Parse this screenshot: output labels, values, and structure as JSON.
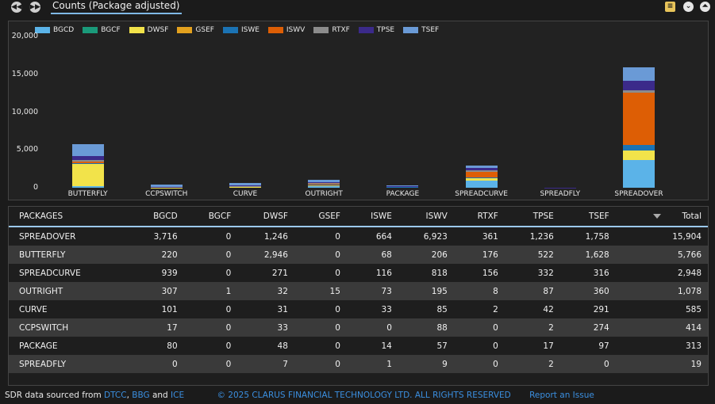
{
  "tab_label": "Counts (Package adjusted)",
  "chart_data": {
    "type": "bar",
    "stacked": true,
    "categories": [
      "BUTTERFLY",
      "CCPSWITCH",
      "CURVE",
      "OUTRIGHT",
      "PACKAGE",
      "SPREADCURVE",
      "SPREADFLY",
      "SPREADOVER"
    ],
    "yticks": [
      "0",
      "5,000",
      "10,000",
      "15,000",
      "20,000"
    ],
    "ylim": [
      0,
      20000
    ],
    "legend_position": "top-left",
    "series": [
      {
        "name": "BGCD",
        "color": "#5bb3e8",
        "values": [
          220,
          17,
          101,
          307,
          80,
          939,
          0,
          3716
        ]
      },
      {
        "name": "BGCF",
        "color": "#1a9a7a",
        "values": [
          0,
          0,
          0,
          1,
          0,
          0,
          0,
          0
        ]
      },
      {
        "name": "DWSF",
        "color": "#f2e34a",
        "values": [
          2946,
          33,
          31,
          32,
          48,
          271,
          7,
          1246
        ]
      },
      {
        "name": "GSEF",
        "color": "#e3a11e",
        "values": [
          0,
          0,
          0,
          15,
          0,
          0,
          0,
          0
        ]
      },
      {
        "name": "ISWE",
        "color": "#1b73b4",
        "values": [
          68,
          0,
          33,
          73,
          14,
          116,
          1,
          664
        ]
      },
      {
        "name": "ISWV",
        "color": "#dd5e05",
        "values": [
          206,
          88,
          85,
          195,
          57,
          818,
          9,
          6923
        ]
      },
      {
        "name": "RTXF",
        "color": "#8c8c8c",
        "values": [
          176,
          0,
          2,
          8,
          0,
          156,
          0,
          361
        ]
      },
      {
        "name": "TPSE",
        "color": "#3b2a8a",
        "values": [
          522,
          2,
          42,
          87,
          17,
          332,
          2,
          1236
        ]
      },
      {
        "name": "TSEF",
        "color": "#6a9ad6",
        "values": [
          1628,
          274,
          291,
          360,
          97,
          316,
          0,
          1758
        ]
      }
    ]
  },
  "table": {
    "headers": [
      "PACKAGES",
      "BGCD",
      "BGCF",
      "DWSF",
      "GSEF",
      "ISWE",
      "ISWV",
      "RTXF",
      "TPSE",
      "TSEF",
      "Total"
    ],
    "rows": [
      [
        "SPREADOVER",
        "3,716",
        "0",
        "1,246",
        "0",
        "664",
        "6,923",
        "361",
        "1,236",
        "1,758",
        "15,904"
      ],
      [
        "BUTTERFLY",
        "220",
        "0",
        "2,946",
        "0",
        "68",
        "206",
        "176",
        "522",
        "1,628",
        "5,766"
      ],
      [
        "SPREADCURVE",
        "939",
        "0",
        "271",
        "0",
        "116",
        "818",
        "156",
        "332",
        "316",
        "2,948"
      ],
      [
        "OUTRIGHT",
        "307",
        "1",
        "32",
        "15",
        "73",
        "195",
        "8",
        "87",
        "360",
        "1,078"
      ],
      [
        "CURVE",
        "101",
        "0",
        "31",
        "0",
        "33",
        "85",
        "2",
        "42",
        "291",
        "585"
      ],
      [
        "CCPSWITCH",
        "17",
        "0",
        "33",
        "0",
        "0",
        "88",
        "0",
        "2",
        "274",
        "414"
      ],
      [
        "PACKAGE",
        "80",
        "0",
        "48",
        "0",
        "14",
        "57",
        "0",
        "17",
        "97",
        "313"
      ],
      [
        "SPREADFLY",
        "0",
        "0",
        "7",
        "0",
        "1",
        "9",
        "0",
        "2",
        "0",
        "19"
      ]
    ]
  },
  "footer": {
    "source_prefix": "SDR data sourced from ",
    "dtcc": "DTCC",
    "comma": ", ",
    "bbg": "BBG",
    "and": " and ",
    "ice": "ICE",
    "copyright": "© 2025 CLARUS FINANCIAL TECHNOLOGY LTD. ALL RIGHTS RESERVED",
    "report": "Report an Issue"
  }
}
